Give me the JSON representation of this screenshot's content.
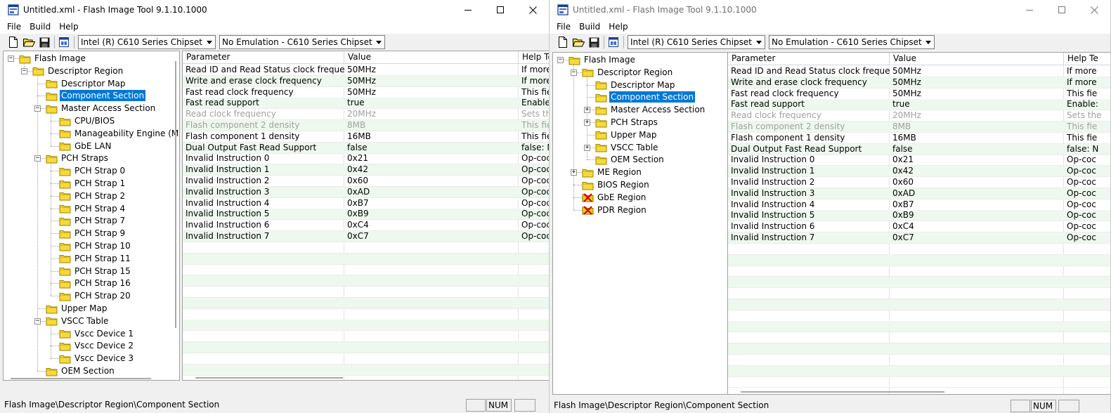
{
  "windows": [
    {
      "title": "Untitled.xml - Flash Image Tool 9.1.10.1000",
      "menu": [
        "File",
        "Build",
        "Help"
      ],
      "chipset_combo": "Intel (R) C610 Series Chipset",
      "emulation_combo": "No Emulation - C610 Series Chipset",
      "tree": [
        {
          "label": "Flash Image",
          "level": 0,
          "exp": "-"
        },
        {
          "label": "Descriptor Region",
          "level": 1,
          "exp": "-"
        },
        {
          "label": "Descriptor Map",
          "level": 2,
          "exp": ""
        },
        {
          "label": "Component Section",
          "level": 2,
          "exp": "",
          "selected": true
        },
        {
          "label": "Master Access Section",
          "level": 2,
          "exp": "-"
        },
        {
          "label": "CPU/BIOS",
          "level": 3,
          "exp": ""
        },
        {
          "label": "Manageability Engine (ME",
          "level": 3,
          "exp": ""
        },
        {
          "label": "GbE LAN",
          "level": 3,
          "exp": ""
        },
        {
          "label": "PCH Straps",
          "level": 2,
          "exp": "-"
        },
        {
          "label": "PCH Strap 0",
          "level": 3,
          "exp": ""
        },
        {
          "label": "PCH Strap 1",
          "level": 3,
          "exp": ""
        },
        {
          "label": "PCH Strap 2",
          "level": 3,
          "exp": ""
        },
        {
          "label": "PCH Strap 4",
          "level": 3,
          "exp": ""
        },
        {
          "label": "PCH Strap 7",
          "level": 3,
          "exp": ""
        },
        {
          "label": "PCH Strap 9",
          "level": 3,
          "exp": ""
        },
        {
          "label": "PCH Strap 10",
          "level": 3,
          "exp": ""
        },
        {
          "label": "PCH Strap 11",
          "level": 3,
          "exp": ""
        },
        {
          "label": "PCH Strap 15",
          "level": 3,
          "exp": ""
        },
        {
          "label": "PCH Strap 16",
          "level": 3,
          "exp": ""
        },
        {
          "label": "PCH Strap 20",
          "level": 3,
          "exp": ""
        },
        {
          "label": "Upper Map",
          "level": 2,
          "exp": ""
        },
        {
          "label": "VSCC Table",
          "level": 2,
          "exp": "-"
        },
        {
          "label": "Vscc Device 1",
          "level": 3,
          "exp": ""
        },
        {
          "label": "Vscc Device 2",
          "level": 3,
          "exp": ""
        },
        {
          "label": "Vscc Device 3",
          "level": 3,
          "exp": ""
        },
        {
          "label": "OEM Section",
          "level": 2,
          "exp": ""
        }
      ],
      "columns": [
        "Parameter",
        "Value",
        "Help Te"
      ],
      "rows": [
        {
          "p": "Read ID and Read Status clock frequency",
          "v": "50MHz",
          "h": "If more",
          "dis": false
        },
        {
          "p": "Write and erase clock frequency",
          "v": "50MHz",
          "h": "If more",
          "dis": false
        },
        {
          "p": "Fast read clock frequency",
          "v": "50MHz",
          "h": "This fie",
          "dis": false
        },
        {
          "p": "Fast read support",
          "v": "true",
          "h": "Enable:",
          "dis": false
        },
        {
          "p": "Read clock frequency",
          "v": "20MHz",
          "h": "Sets the",
          "dis": true
        },
        {
          "p": "Flash component 2 density",
          "v": "8MB",
          "h": "This fie",
          "dis": true
        },
        {
          "p": "Flash component 1 density",
          "v": "16MB",
          "h": "This fie",
          "dis": false
        },
        {
          "p": "Dual Output Fast Read Support",
          "v": "false",
          "h": "false: N",
          "dis": false
        },
        {
          "p": "Invalid Instruction 0",
          "v": "0x21",
          "h": "Op-coc",
          "dis": false
        },
        {
          "p": "Invalid Instruction 1",
          "v": "0x42",
          "h": "Op-coc",
          "dis": false
        },
        {
          "p": "Invalid Instruction 2",
          "v": "0x60",
          "h": "Op-coc",
          "dis": false
        },
        {
          "p": "Invalid Instruction 3",
          "v": "0xAD",
          "h": "Op-coc",
          "dis": false
        },
        {
          "p": "Invalid Instruction 4",
          "v": "0xB7",
          "h": "Op-coc",
          "dis": false
        },
        {
          "p": "Invalid Instruction 5",
          "v": "0xB9",
          "h": "Op-coc",
          "dis": false
        },
        {
          "p": "Invalid Instruction 6",
          "v": "0xC4",
          "h": "Op-coc",
          "dis": false
        },
        {
          "p": "Invalid Instruction 7",
          "v": "0xC7",
          "h": "Op-coc",
          "dis": false
        }
      ],
      "status": "Flash Image\\Descriptor Region\\Component Section",
      "num": "NUM"
    },
    {
      "title": "Untitled.xml - Flash Image Tool 9.1.10.1000",
      "menu": [
        "File",
        "Build",
        "Help"
      ],
      "chipset_combo": "Intel (R) C610 Series Chipset",
      "emulation_combo": "No Emulation - C610 Series Chipset",
      "tree": [
        {
          "label": "Flash Image",
          "level": 0,
          "exp": "-"
        },
        {
          "label": "Descriptor Region",
          "level": 1,
          "exp": "-"
        },
        {
          "label": "Descriptor Map",
          "level": 2,
          "exp": ""
        },
        {
          "label": "Component Section",
          "level": 2,
          "exp": "",
          "selected": true
        },
        {
          "label": "Master Access Section",
          "level": 2,
          "exp": "+"
        },
        {
          "label": "PCH Straps",
          "level": 2,
          "exp": "+"
        },
        {
          "label": "Upper Map",
          "level": 2,
          "exp": ""
        },
        {
          "label": "VSCC Table",
          "level": 2,
          "exp": "+"
        },
        {
          "label": "OEM Section",
          "level": 2,
          "exp": ""
        },
        {
          "label": "ME Region",
          "level": 1,
          "exp": "+"
        },
        {
          "label": "BIOS Region",
          "level": 1,
          "exp": ""
        },
        {
          "label": "GbE Region",
          "level": 1,
          "exp": "",
          "disabled": true
        },
        {
          "label": "PDR Region",
          "level": 1,
          "exp": "",
          "disabled": true
        }
      ],
      "columns": [
        "Parameter",
        "Value",
        "Help Te"
      ],
      "rows": [
        {
          "p": "Read ID and Read Status clock frequency",
          "v": "50MHz",
          "h": "If more",
          "dis": false
        },
        {
          "p": "Write and erase clock frequency",
          "v": "50MHz",
          "h": "If more",
          "dis": false
        },
        {
          "p": "Fast read clock frequency",
          "v": "50MHz",
          "h": "This fie",
          "dis": false
        },
        {
          "p": "Fast read support",
          "v": "true",
          "h": "Enable:",
          "dis": false
        },
        {
          "p": "Read clock frequency",
          "v": "20MHz",
          "h": "Sets the",
          "dis": true
        },
        {
          "p": "Flash component 2 density",
          "v": "8MB",
          "h": "This fie",
          "dis": true
        },
        {
          "p": "Flash component 1 density",
          "v": "16MB",
          "h": "This fie",
          "dis": false
        },
        {
          "p": "Dual Output Fast Read Support",
          "v": "false",
          "h": "false: N",
          "dis": false
        },
        {
          "p": "Invalid Instruction 0",
          "v": "0x21",
          "h": "Op-coc",
          "dis": false
        },
        {
          "p": "Invalid Instruction 1",
          "v": "0x42",
          "h": "Op-coc",
          "dis": false
        },
        {
          "p": "Invalid Instruction 2",
          "v": "0x60",
          "h": "Op-coc",
          "dis": false
        },
        {
          "p": "Invalid Instruction 3",
          "v": "0xAD",
          "h": "Op-coc",
          "dis": false
        },
        {
          "p": "Invalid Instruction 4",
          "v": "0xB7",
          "h": "Op-coc",
          "dis": false
        },
        {
          "p": "Invalid Instruction 5",
          "v": "0xB9",
          "h": "Op-coc",
          "dis": false
        },
        {
          "p": "Invalid Instruction 6",
          "v": "0xC4",
          "h": "Op-coc",
          "dis": false
        },
        {
          "p": "Invalid Instruction 7",
          "v": "0xC7",
          "h": "Op-coc",
          "dis": false
        }
      ],
      "status": "Flash Image\\Descriptor Region\\Component Section",
      "num": "NUM"
    }
  ],
  "colors": {
    "selection": "#0078d7",
    "alt_row": "#eef8ee",
    "folder": "#f5d000",
    "disabled_text": "#a0a0a0"
  }
}
